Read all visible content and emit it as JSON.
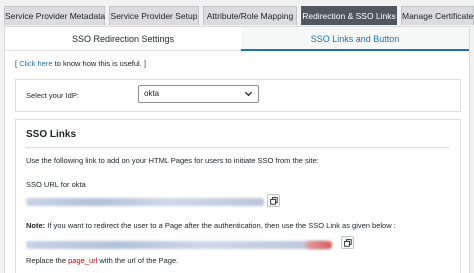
{
  "top_tabs": [
    {
      "label": "Service Provider Metadata",
      "active": false
    },
    {
      "label": "Service Provider Setup",
      "active": false
    },
    {
      "label": "Attribute/Role Mapping",
      "active": false
    },
    {
      "label": "Redirection & SSO Links",
      "active": true
    },
    {
      "label": "Manage Certificate",
      "active": false
    }
  ],
  "sub_tabs": [
    {
      "label": "SSO Redirection Settings",
      "active": false
    },
    {
      "label": "SSO Links and Button",
      "active": true
    }
  ],
  "help": {
    "open_bracket": "[",
    "link": "Click here",
    "text": "to know how this is useful.",
    "close_bracket": "]"
  },
  "idp": {
    "label": "Select your IdP:",
    "selected": "okta"
  },
  "sso_links": {
    "title": "SSO Links",
    "description": "Use the following link to add on your HTML Pages for users to initiate SSO from the site:",
    "url_label": "SSO URL for okta",
    "note_prefix": "Note:",
    "note_text": "If you want to redirect the user to a Page after the authentication, then use the SSO Link as given below :",
    "replace_prefix": "Replace the",
    "replace_code": "page_url",
    "replace_suffix": "with the url of the Page."
  },
  "colors": {
    "active_tab_bg": "#50575e",
    "accent": "#2271b1",
    "highlight_red": "#cc0000"
  }
}
